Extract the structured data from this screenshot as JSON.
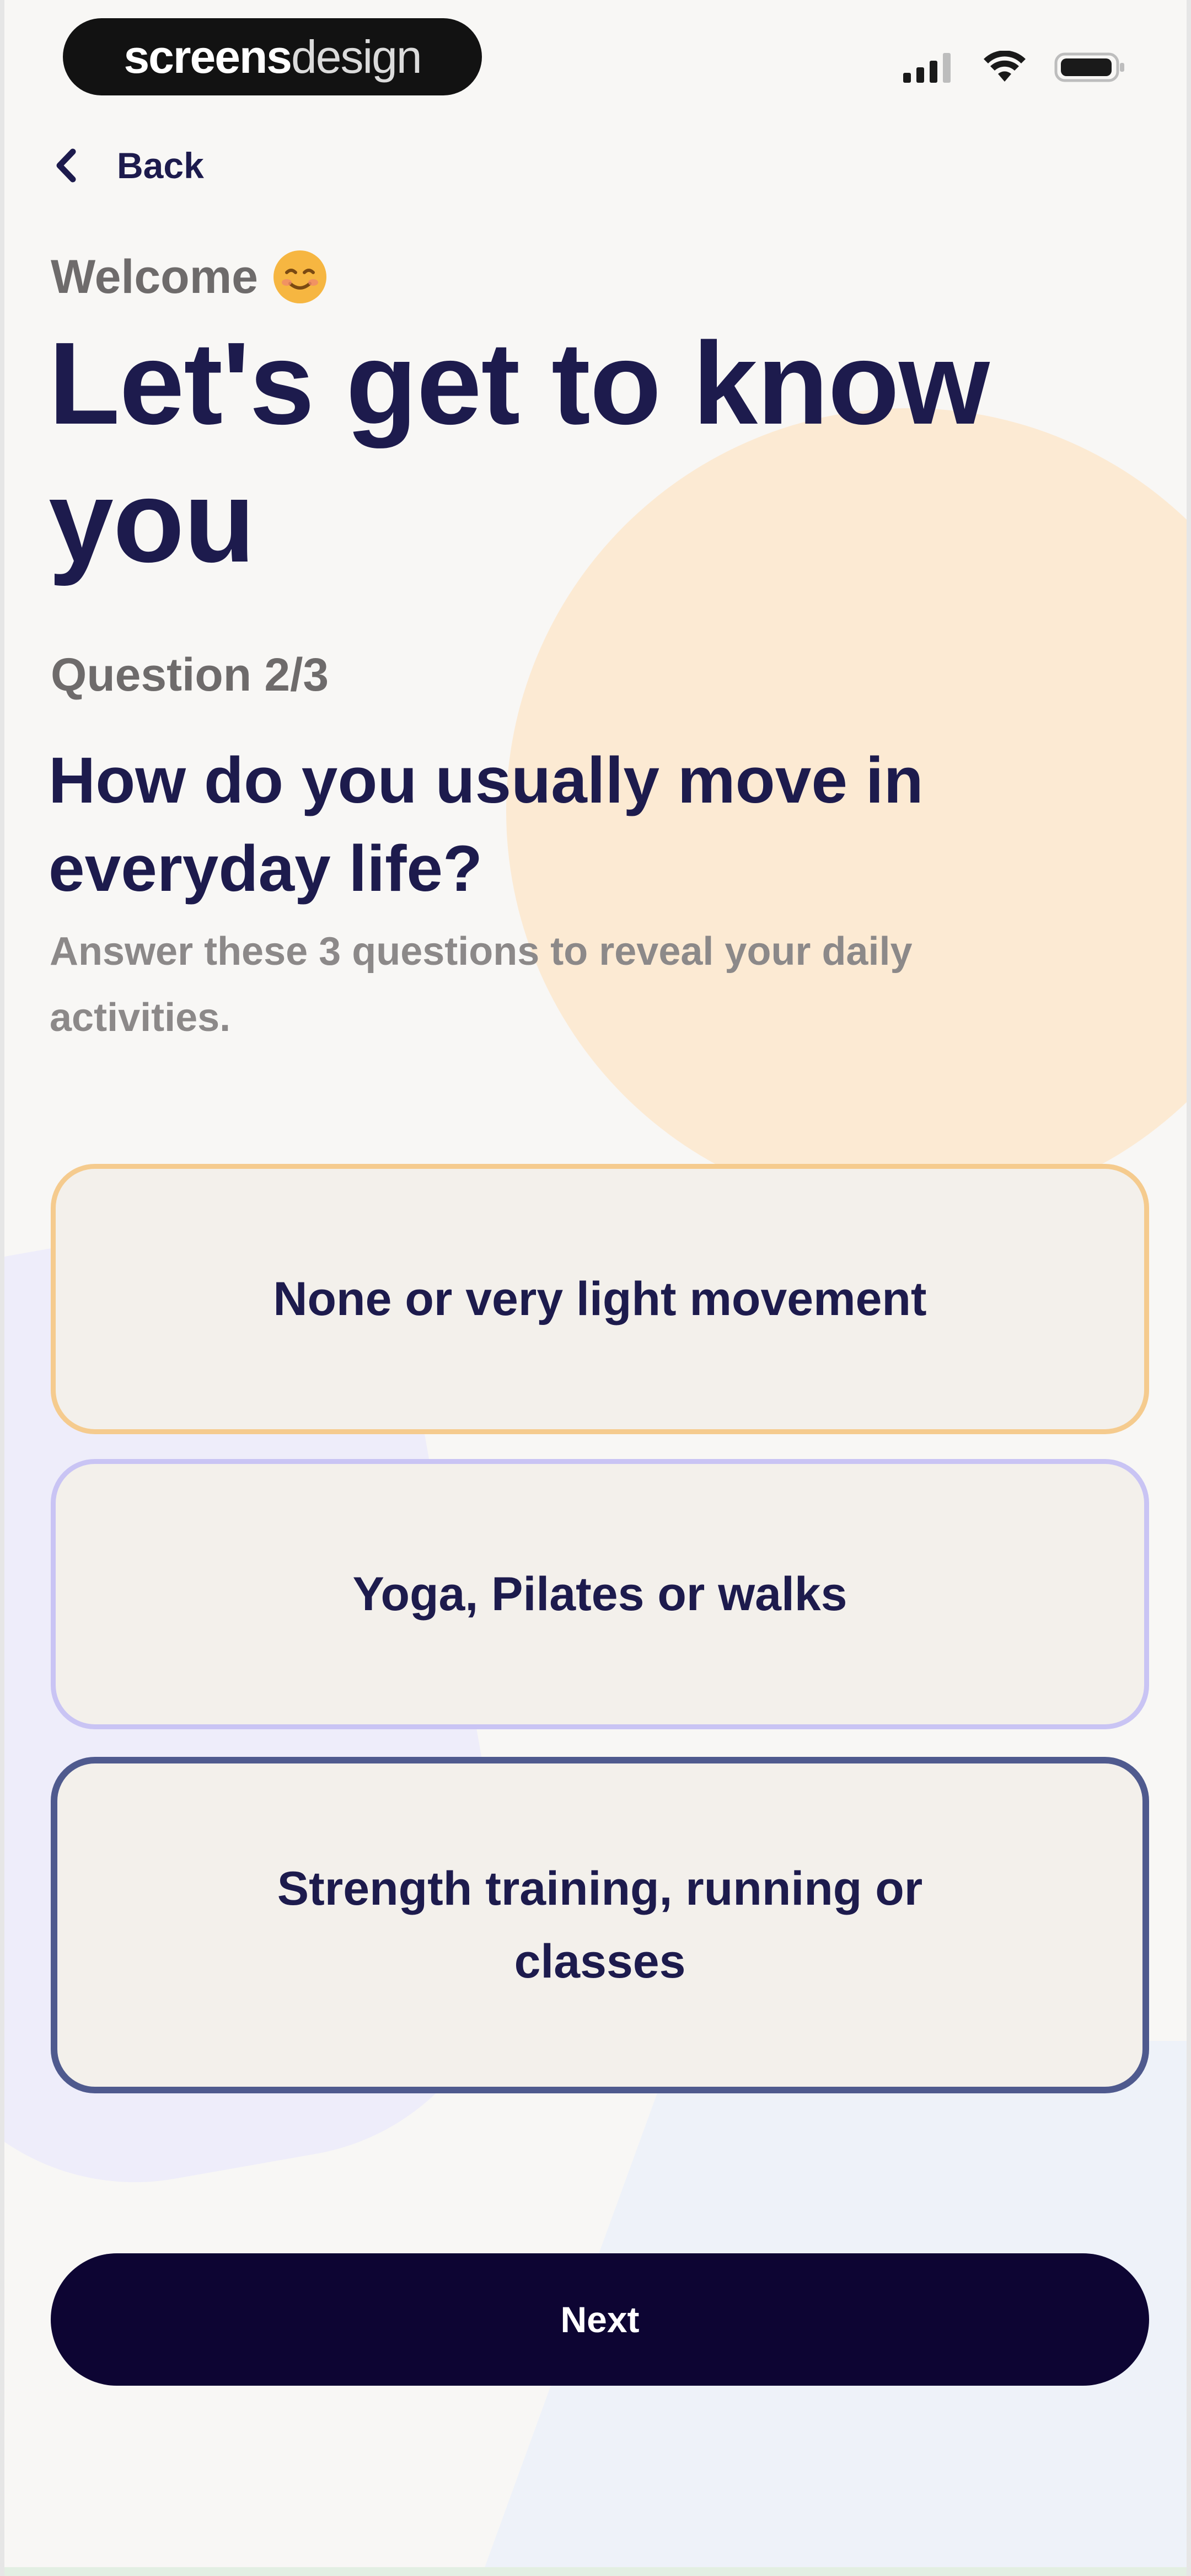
{
  "status_bar": {
    "brand_part1": "screens",
    "brand_part2": "design"
  },
  "nav": {
    "back_label": "Back"
  },
  "header": {
    "welcome": "Welcome",
    "title": "Let's get to know you"
  },
  "question": {
    "count": "Question 2/3",
    "text": "How do you usually move in everyday life?",
    "subtitle": "Answer these 3 questions to reveal your daily activities."
  },
  "options": [
    {
      "label": "None or very light movement",
      "border_color": "#f5cb8e"
    },
    {
      "label": "Yoga, Pilates or walks",
      "border_color": "#c9c4f4"
    },
    {
      "label": "Strength training, running or classes",
      "border_color": "#4f5a8e"
    }
  ],
  "footer": {
    "next_label": "Next"
  },
  "colors": {
    "primary_text": "#1d1b4d",
    "button_bg": "#0d0533",
    "accent_circle": "#fde8cc"
  },
  "icons": {
    "welcome_emoji": "smiling-face-emoji-icon",
    "back": "chevron-left-icon",
    "signal": "cellular-signal-icon",
    "wifi": "wifi-icon",
    "battery": "battery-icon"
  }
}
